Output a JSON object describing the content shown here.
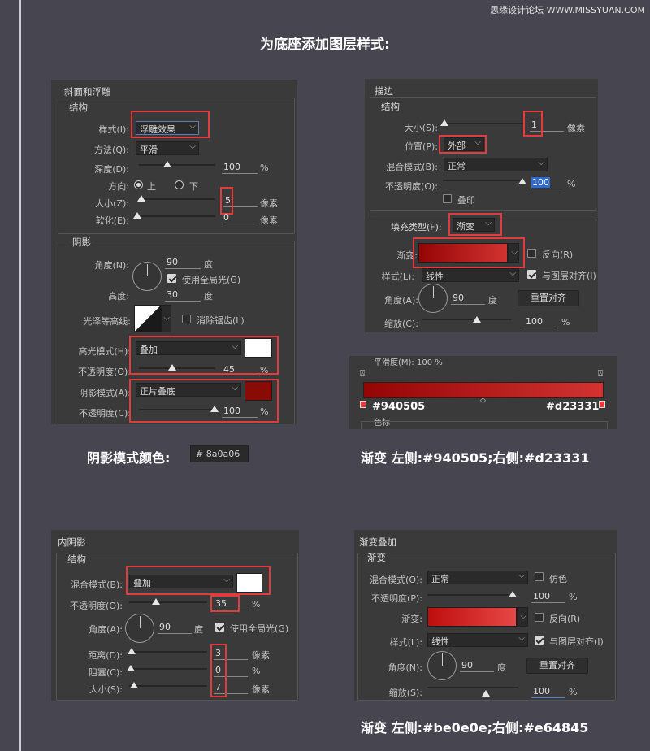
{
  "watermark": "思缘设计论坛 WWW.MISSYUAN.COM",
  "title": "为底座添加图层样式:",
  "bevel": {
    "title": "斜面和浮雕",
    "struct": "结构",
    "style_lbl": "样式(I):",
    "style_val": "浮雕效果",
    "method_lbl": "方法(Q):",
    "method_val": "平滑",
    "depth_lbl": "深度(D):",
    "depth_val": "100",
    "depth_unit": "%",
    "dir_lbl": "方向:",
    "dir_up": "上",
    "dir_down": "下",
    "size_lbl": "大小(Z):",
    "size_val": "5",
    "size_unit": "像素",
    "soften_lbl": "软化(E):",
    "soften_val": "0",
    "soften_unit": "像素",
    "shading": "阴影",
    "angle_lbl": "角度(N):",
    "angle_val": "90",
    "angle_unit": "度",
    "global_light": "使用全局光(G)",
    "alt_lbl": "高度:",
    "alt_val": "30",
    "alt_unit": "度",
    "gloss_lbl": "光泽等高线:",
    "antialias": "消除锯齿(L)",
    "hl_mode_lbl": "高光模式(H):",
    "hl_mode_val": "叠加",
    "hl_op_lbl": "不透明度(O):",
    "hl_op_val": "45",
    "hl_op_unit": "%",
    "sh_mode_lbl": "阴影模式(A):",
    "sh_mode_val": "正片叠底",
    "sh_op_lbl": "不透明度(C):",
    "sh_op_val": "100",
    "sh_op_unit": "%",
    "hl_color": "#ffffff",
    "sh_color": "#8a0a06"
  },
  "shadow_caption": "阴影模式颜色:",
  "shadow_hex": "# 8a0a06",
  "stroke": {
    "title": "描边",
    "struct": "结构",
    "size_lbl": "大小(S):",
    "size_val": "1",
    "size_unit": "像素",
    "pos_lbl": "位置(P):",
    "pos_val": "外部",
    "blend_lbl": "混合模式(B):",
    "blend_val": "正常",
    "op_lbl": "不透明度(O):",
    "op_val": "100",
    "op_unit": "%",
    "overprint": "叠印",
    "fill_lbl": "填充类型(F):",
    "fill_val": "渐变",
    "grad_lbl": "渐变:",
    "reverse": "反向(R)",
    "style_lbl": "样式(L):",
    "style_val": "线性",
    "align": "与图层对齐(I)",
    "angle_lbl": "角度(A):",
    "angle_val": "90",
    "angle_unit": "度",
    "reset": "重置对齐",
    "scale_lbl": "缩放(C):",
    "scale_val": "100",
    "scale_unit": "%"
  },
  "gradbar": {
    "top_text": "平滑度(M): 100 %",
    "left_hex": "#940505",
    "right_hex": "#d23331",
    "stop_lbl": "色标",
    "left_color": "#940505",
    "right_color": "#d23331"
  },
  "stroke_caption": "渐变 左侧:#940505;右侧:#d23331",
  "inner": {
    "title": "内阴影",
    "struct": "结构",
    "blend_lbl": "混合模式(B):",
    "blend_val": "叠加",
    "op_lbl": "不透明度(O):",
    "op_val": "35",
    "op_unit": "%",
    "angle_lbl": "角度(A):",
    "angle_val": "90",
    "angle_unit": "度",
    "global_light": "使用全局光(G)",
    "dist_lbl": "距离(D):",
    "dist_val": "3",
    "dist_unit": "像素",
    "choke_lbl": "阻塞(C):",
    "choke_val": "0",
    "choke_unit": "%",
    "size_lbl": "大小(S):",
    "size_val": "7",
    "size_unit": "像素",
    "color": "#ffffff"
  },
  "overlay": {
    "title": "渐变叠加",
    "sub": "渐变",
    "blend_lbl": "混合模式(O):",
    "blend_val": "正常",
    "dither": "仿色",
    "op_lbl": "不透明度(P):",
    "op_val": "100",
    "op_unit": "%",
    "grad_lbl": "渐变:",
    "reverse": "反向(R)",
    "style_lbl": "样式(L):",
    "style_val": "线性",
    "align": "与图层对齐(I)",
    "angle_lbl": "角度(N):",
    "angle_val": "90",
    "angle_unit": "度",
    "reset": "重置对齐",
    "scale_lbl": "缩放(S):",
    "scale_val": "100",
    "scale_unit": "%",
    "left_color": "#be0e0e",
    "right_color": "#e64845"
  },
  "overlay_caption": "渐变 左侧:#be0e0e;右侧:#e64845"
}
